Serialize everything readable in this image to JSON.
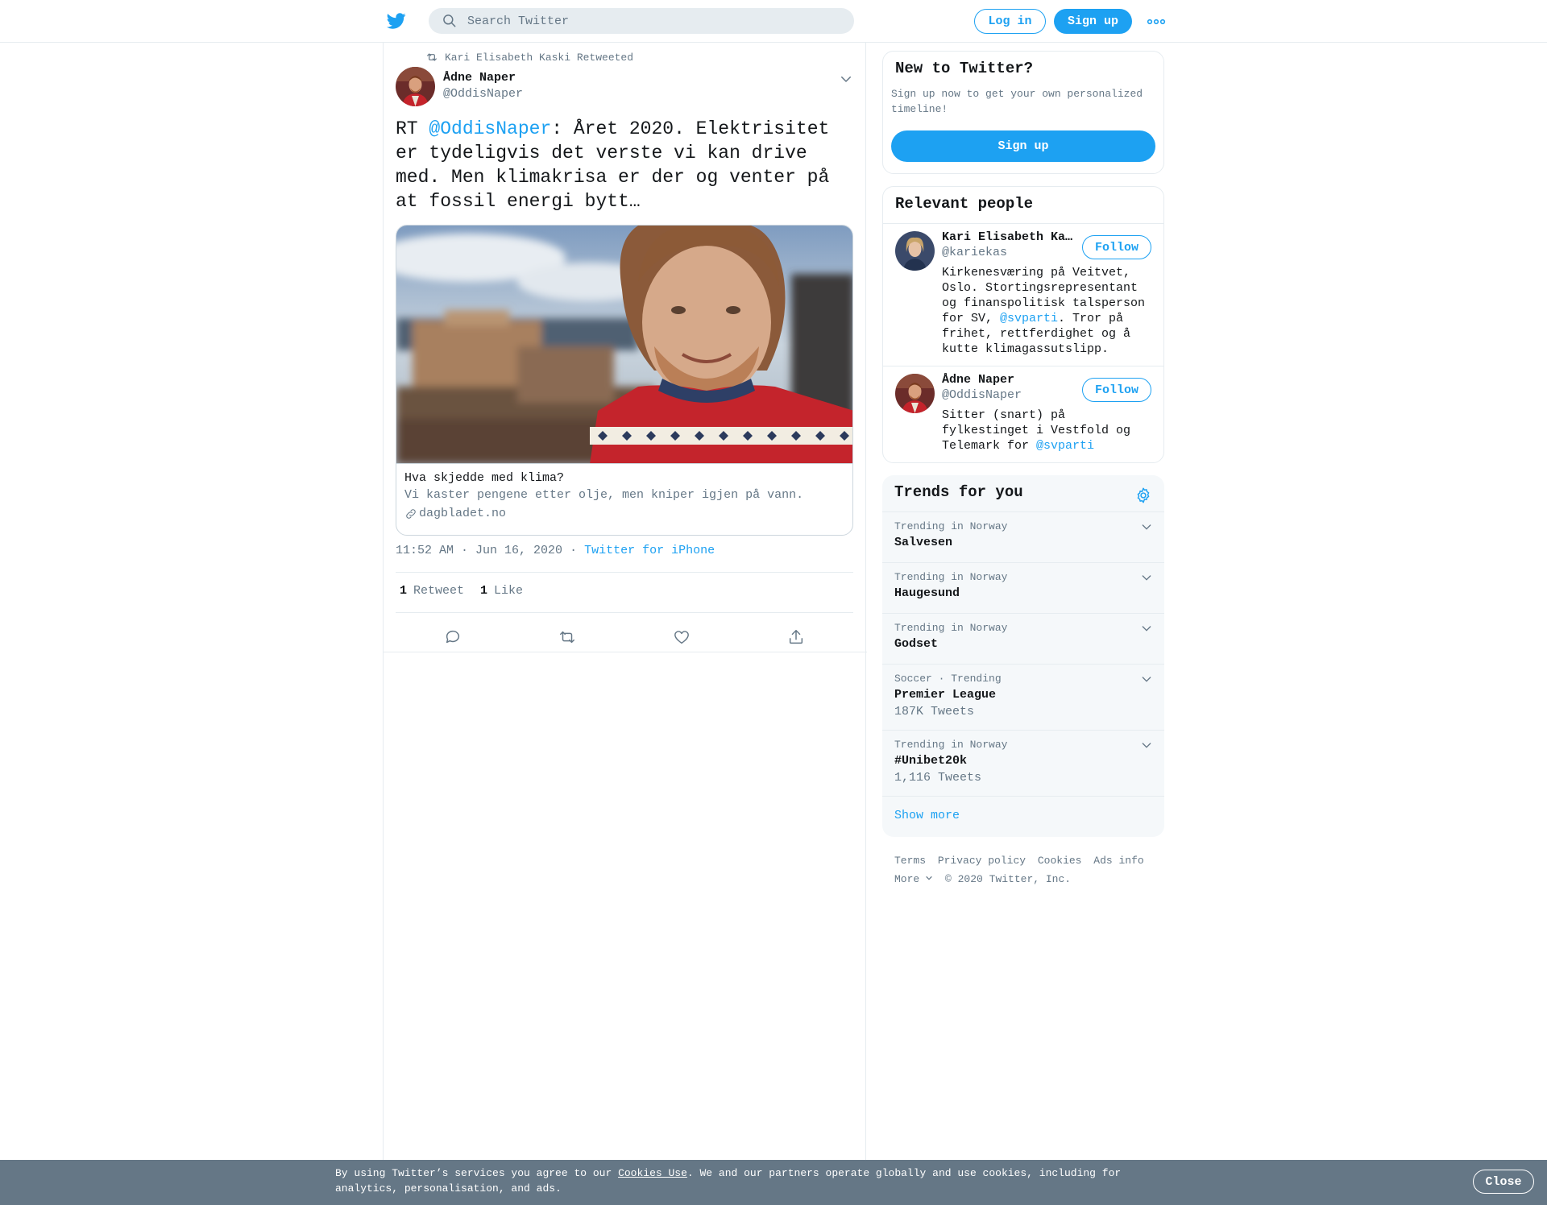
{
  "header": {
    "search_placeholder": "Search Twitter",
    "login_label": "Log in",
    "signup_label": "Sign up",
    "logo_icon": "twitter-bird-icon",
    "more_icon": "more-dots-icon",
    "accent_color": "#1da1f2"
  },
  "tweet": {
    "retweeted_by": "Kari Elisabeth Kaski Retweeted",
    "author_name": "Ådne Naper",
    "author_handle": "@OddisNaper",
    "text_prefix": "RT ",
    "text_mention": "@OddisNaper",
    "text_body": ": Året 2020. Elektrisitet er tydeligvis det verste vi kan drive med. Men klimakrisa er der og venter på at fossil energi bytt…",
    "card": {
      "title": "Hva skjedde med klima?",
      "description": "Vi kaster pengene etter olje, men kniper igjen på vann.",
      "domain": "dagbladet.no"
    },
    "timestamp": "11:52 AM · Jun 16, 2020",
    "meta_separator": "·",
    "source": "Twitter for iPhone",
    "retweet_count": "1",
    "retweet_label": "Retweet",
    "like_count": "1",
    "like_label": "Like"
  },
  "signup_panel": {
    "title": "New to Twitter?",
    "text": "Sign up now to get your own personalized timeline!",
    "button": "Sign up"
  },
  "relevant_people": {
    "title": "Relevant people",
    "people": [
      {
        "name": "Kari Elisabeth Ka…",
        "handle": "@kariekas",
        "follow": "Follow",
        "bio_before": "Kirkenesværing på Veitvet, Oslo. Stortingsrepresentant og finanspolitisk talsperson for SV, ",
        "bio_mention": "@svparti",
        "bio_after": ". Tror på frihet, rettferdighet og å kutte klimagassutslipp."
      },
      {
        "name": "Ådne Naper",
        "handle": "@OddisNaper",
        "follow": "Follow",
        "bio_before": "Sitter (snart) på fylkestinget i Vestfold og Telemark for ",
        "bio_mention": "@svparti",
        "bio_after": ""
      }
    ]
  },
  "trends": {
    "title": "Trends for you",
    "items": [
      {
        "context": "Trending in Norway",
        "name": "Salvesen",
        "count": ""
      },
      {
        "context": "Trending in Norway",
        "name": "Haugesund",
        "count": ""
      },
      {
        "context": "Trending in Norway",
        "name": "Godset",
        "count": ""
      },
      {
        "context": "Soccer · Trending",
        "name": "Premier League",
        "count": "187K Tweets"
      },
      {
        "context": "Trending in Norway",
        "name": "#Unibet20k",
        "count": "1,116 Tweets"
      }
    ],
    "show_more": "Show more"
  },
  "footer": {
    "links": [
      "Terms",
      "Privacy policy",
      "Cookies",
      "Ads info"
    ],
    "more": "More",
    "copyright": "© 2020 Twitter, Inc."
  },
  "cookie_bar": {
    "text_before": "By using Twitter’s services you agree to our ",
    "link": "Cookies Use",
    "text_after": ". We and our partners operate globally and use cookies, including for analytics, personalisation, and ads.",
    "close": "Close"
  }
}
